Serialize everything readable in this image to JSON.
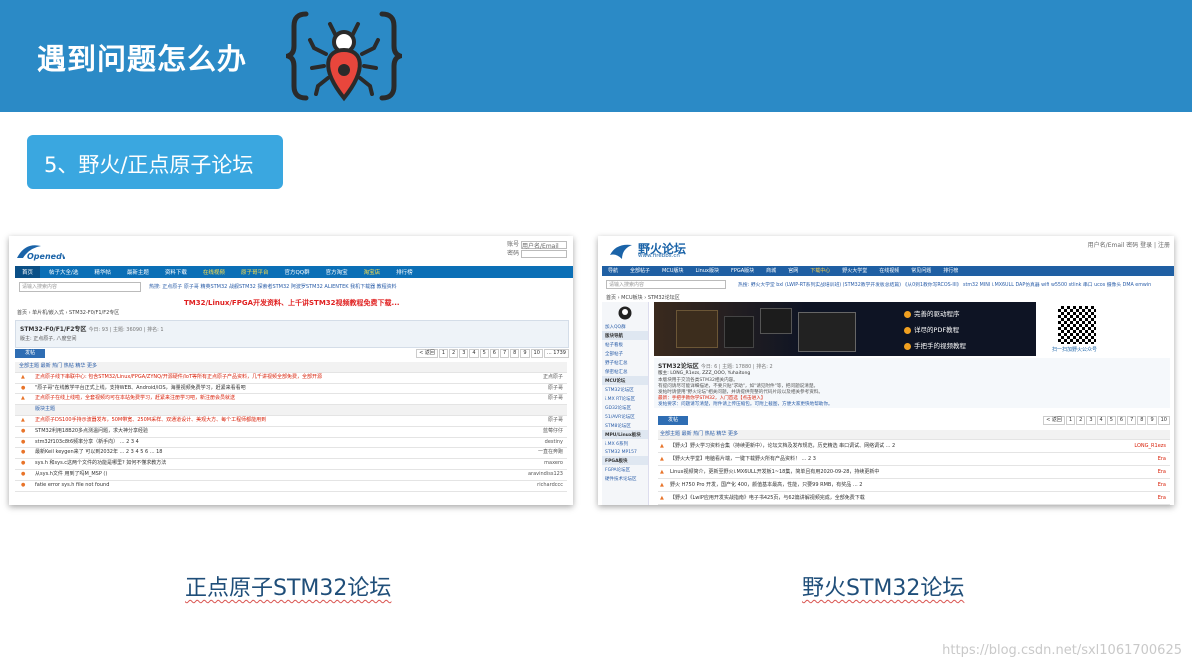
{
  "header": {
    "title": "遇到问题怎么办",
    "icon": "bug-icon",
    "bg_color": "#2b8ac6"
  },
  "badge": {
    "label": "5、野火/正点原子论坛",
    "color": "#3aa7e0"
  },
  "left_shot": {
    "caption": "正点原子STM32论坛",
    "logo_text": "Openedv",
    "login": {
      "user": "账号",
      "password": "密码",
      "placeholder": "用户名/Email"
    },
    "nav": [
      "首页",
      "帖子大全/选",
      "精华帖",
      "最新主题",
      "资料下载",
      "在线视频",
      "原子哥平台",
      "官方QQ群",
      "官方淘宝",
      "淘宝店",
      "排行榜"
    ],
    "search_placeholder": "请输入搜索内容",
    "hot": "热搜: 正点原子 原子哥 精英STM32 战舰STM32 探索者STM32 阿波罗STM32 ALIENTEK 我机下载器 教程资料",
    "red_banner": "TM32/Linux/FPGA开发资料、上千讲STM32视频教程免费下载...",
    "breadcrumb": "首页 › 单片机/嵌入式 › STM32-F0/F1/F2专区",
    "forum": {
      "title": "STM32-F0/F1/F2专区",
      "stats": "今日: 93 | 主题: 36090 | 排名: 1",
      "mods": "版主: 正点原子, 八度空间"
    },
    "post_button": "发帖",
    "pages": [
      "< 返回",
      "1",
      "2",
      "3",
      "4",
      "5",
      "6",
      "7",
      "8",
      "9",
      "10",
      "... 1739"
    ],
    "list_header": "全部主题  最新  热门  热帖  精华  更多",
    "rows": [
      {
        "text": "正点原子线下串联中心: 包含STM32/Linux/FPGA/ZYNQ/开源硬件/IoT等所有正点原子产品资料，几千讲视频全部免费，全部开源",
        "author": "正点原子",
        "red": true
      },
      {
        "text": "\"原子哥\"在线教学平台正式上线，支持WEB、Android/iOS，海量视频免费学习，赶紧来看看吧",
        "author": "原子哥",
        "red": false
      },
      {
        "text": "正点原子在线上线啦，全套视频均可在本站免费学习，赶紧来注册学习吧，新注册会员就送",
        "author": "原子哥",
        "red": true
      },
      {
        "text": "版块主题",
        "author": "",
        "red": false,
        "header": true
      },
      {
        "text": "正点原子DS100手持示波器发布，50M带宽、250M采样、双通道设计、美观大方、每个工程师都能用到",
        "author": "原子哥",
        "red": true
      },
      {
        "text": "STM32利用18B20多点测温问题，求大神分享经验",
        "author": "蓝莓仔仔",
        "red": false
      },
      {
        "text": "stm32f103c8t6频率分享（新手向）  ... 2 3 4",
        "author": "destiny",
        "red": false
      },
      {
        "text": "最新Keil keygen来了 可以到2032年  ... 2 3 4 5 6 ... 18",
        "author": "一直在奔跑",
        "red": false
      },
      {
        "text": "sys.h 和sys.c这两个文件的功能是哪里? 如何不懂求教方法",
        "author": "maxero",
        "red": false
      },
      {
        "text": "从sys.h文件 用到了吗M_MSP ()",
        "author": "aravindiss123",
        "red": false
      },
      {
        "text": "fatie error sys.h file not found",
        "author": "richardccc",
        "red": false
      }
    ]
  },
  "right_shot": {
    "caption": "野火STM32论坛",
    "logo_name": "野火论坛",
    "logo_url": "www.firebbs.cn",
    "login": "用户名/Email  密码  登录 | 注册",
    "nav": [
      "导航",
      "全部帖子",
      "MCU版块",
      "Linux版块",
      "FPGA版块",
      "商城",
      "官网",
      "下载中心",
      "野火大学堂",
      "在线视频",
      "常见问题",
      "排行榜"
    ],
    "search_placeholder": "请输入搜索内容",
    "hot": "热搜: 野火大学堂  bxl  (LWIP-RT系列实战培训班)  (STM32教学开发板总结篇)  《从0到1教你写RCOS-III》  stm32 MINI  i.MX6ULL  DAP仿真器  wifi  w5500  stlink  串口  ucos  摄像头  DMA  emwin",
    "breadcrumb": "首页 › MCU板块 › STM32论坛区",
    "sidebar": [
      "加入QQ群",
      "版块导航",
      "帖子看板",
      "全部帖子",
      "野子帖汇总",
      "保密帖汇总",
      "MCU论坛",
      "STM32论坛区",
      "i.MX RT论坛区",
      "GD32论坛区",
      "51/AVR论坛区",
      "STM8论坛区",
      "MPU/Linux板块",
      "i.MX 6系列",
      "STM32 MP157",
      "FPGA板块",
      "FGPA论坛区",
      "硬件技术论坛区"
    ],
    "banner": [
      "完善的驱动程序",
      "详尽的PDF教程",
      "手把手的视频教程"
    ],
    "qr_caption": "扫一扫加野火公众号",
    "forum": {
      "title": "STM32论坛区",
      "stats": "今日: 6 | 主题: 17880 | 排名: 2",
      "mods": "版主: LONG_R1ezs, ZZZ_OOO, Yuhaitong",
      "desc": "本版块用于交流各类STM32相关内容。",
      "note1": "有提问请尽可能详细描述，不要只贴\"求助\"，如\"请见附件\"等，把问题说清楚。",
      "note2": "发帖时请使用\"野火论坛\"相关问题，并请提供完整的代码片段以及相关参考资料。",
      "link1": "最新：手把手教你学STM32，入门首选【点击进入】",
      "link2": "发帖要求：问题请写清楚，附件请上传压缩包。可附上截图，方便大家更快地帮助你。"
    },
    "post_button": "发帖",
    "pages": [
      "< 返回",
      "1",
      "2",
      "3",
      "4",
      "5",
      "6",
      "7",
      "8",
      "9",
      "10"
    ],
    "list_header": "全部主题  最新  热门  热帖  精华  更多",
    "rows": [
      {
        "text": "【野火】野火学习资料合集（持续更新中），论坛文档及发布规范，历史精选  串口调试、网络调试 ... 2",
        "author": "LONG_R1ezs"
      },
      {
        "text": "【野火大学堂】电脑看片端，一键下载野火所有产品资料！  ... 2 3",
        "author": "Era"
      },
      {
        "text": "Linux视频简介，更新至野火i.MX6ULL开发板1~18集，简单且有用2020-09-28，持续更新中",
        "author": "Era"
      },
      {
        "text": "野火 H750 Pro 开发，国产化 400，颜值基本最高，性能，只要99 RMB，有奖品  ... 2",
        "author": "Era"
      },
      {
        "text": "【野火】《LwIP应用开发实战指南》电子书425页，与62篇讲解视频完成，全部免费下载",
        "author": "Era"
      }
    ]
  },
  "watermark": "https://blog.csdn.net/sxl1061700625"
}
